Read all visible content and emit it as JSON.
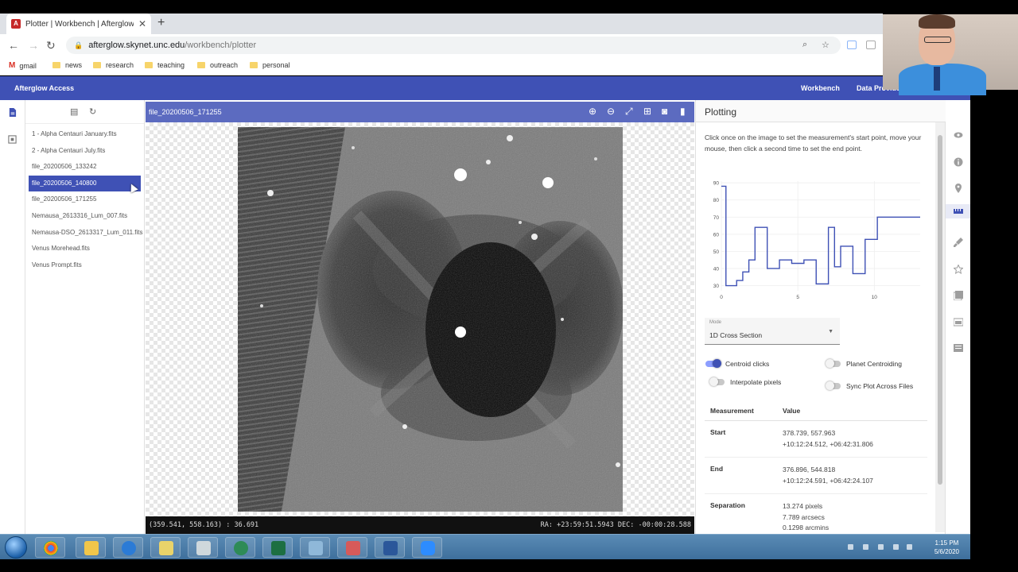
{
  "browser": {
    "tab_title": "Plotter | Workbench | Afterglow A",
    "tab_favicon": "A",
    "url_host": "afterglow.skynet.unc.edu",
    "url_path": "/workbench/plotter",
    "bookmarks": [
      "gmail",
      "news",
      "research",
      "teaching",
      "outreach",
      "personal"
    ]
  },
  "appbar": {
    "brand": "Afterglow Access",
    "nav": [
      "Workbench",
      "Data Providers"
    ]
  },
  "files": {
    "items": [
      "1 - Alpha Centauri January.fits",
      "2 - Alpha Centauri July.fits",
      "file_20200506_133242",
      "file_20200506_140800",
      "file_20200506_171255",
      "Nemausa_2613316_Lum_007.fits",
      "Nemausa-DSO_2613317_Lum_011.fits",
      "Venus Morehead.fits",
      "Venus Prompt.fits"
    ],
    "selected_index": 3
  },
  "viewer": {
    "filename": "file_20200506_171255",
    "status_left": "(359.541, 558.163) : 36.691",
    "status_right": "RA: +23:59:51.5943 DEC: -00:00:28.588"
  },
  "plotting": {
    "title": "Plotting",
    "instructions": "Click once on the image to set the measurement's start point, move your mouse, then click a second time to set the end point.",
    "mode_label": "Mode",
    "mode_value": "1D Cross Section",
    "toggles": {
      "centroid_clicks": {
        "label": "Centroid clicks",
        "on": true
      },
      "planet_centroiding": {
        "label": "Planet Centroiding",
        "on": false
      },
      "interpolate_pixels": {
        "label": "Interpolate pixels",
        "on": false
      },
      "sync_plot": {
        "label": "Sync Plot Across Files",
        "on": false
      }
    },
    "table": {
      "col_measurement": "Measurement",
      "col_value": "Value",
      "start_label": "Start",
      "start_px": "378.739, 557.963",
      "start_sky": "+10:12:24.512, +06:42:31.806",
      "end_label": "End",
      "end_px": "376.896, 544.818",
      "end_sky": "+10:12:24.591, +06:42:24.107",
      "sep_label": "Separation",
      "sep_px": "13.274 pixels",
      "sep_arcsec": "7.789 arcsecs",
      "sep_arcmin": "0.1298 arcmins"
    }
  },
  "chart_data": {
    "type": "line",
    "x": [
      0,
      0.3,
      0.6,
      1,
      1.4,
      1.8,
      2.2,
      2.6,
      3,
      3.4,
      3.8,
      4.2,
      4.6,
      5,
      5.4,
      5.8,
      6.2,
      6.6,
      7,
      7.4,
      7.8,
      8.2,
      8.6,
      9,
      9.4,
      9.8,
      10.2,
      10.6,
      11,
      11.4,
      11.8,
      12.2,
      12.6,
      13
    ],
    "values": [
      88,
      30,
      30,
      33,
      38,
      45,
      64,
      64,
      40,
      40,
      45,
      45,
      43,
      43,
      45,
      45,
      31,
      31,
      64,
      41,
      53,
      53,
      37,
      37,
      57,
      57,
      70,
      70,
      70,
      70,
      70,
      70,
      70,
      70
    ],
    "xticks": [
      0,
      5,
      10
    ],
    "yticks": [
      30,
      40,
      50,
      60,
      70,
      80,
      90
    ],
    "xlim": [
      0,
      13
    ],
    "ylim": [
      27,
      91
    ],
    "grid": true,
    "color": "#3f51b5"
  },
  "taskbar": {
    "time": "1:15 PM",
    "date": "5/6/2020"
  }
}
